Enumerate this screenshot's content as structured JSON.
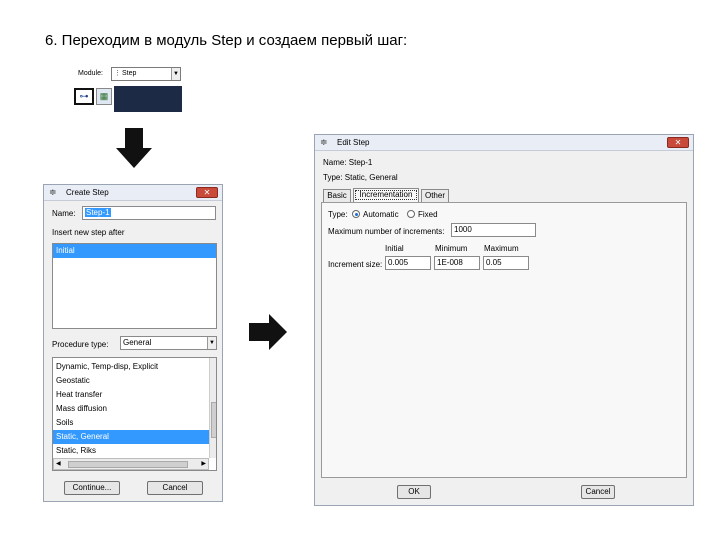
{
  "heading": "6. Переходим в модуль Step и создаем первый шаг:",
  "module_bar": {
    "label": "Module:",
    "value": "Step",
    "panel_color": "#1c2a45"
  },
  "create_step": {
    "title": "Create Step",
    "name_label": "Name:",
    "name_value": "Step-1",
    "insert_label": "Insert new step after",
    "after_items": [
      "Initial"
    ],
    "procedure_label": "Procedure type:",
    "procedure_value": "General",
    "procedures": [
      "Dynamic, Temp-disp, Explicit",
      "Geostatic",
      "Heat transfer",
      "Mass diffusion",
      "Soils",
      "Static, General",
      "Static, Riks"
    ],
    "selected_procedure": "Static, General",
    "continue_label": "Continue...",
    "cancel_label": "Cancel"
  },
  "edit_step": {
    "title": "Edit Step",
    "name_line": "Name: Step-1",
    "type_line": "Type: Static, General",
    "tabs": [
      "Basic",
      "Incrementation",
      "Other"
    ],
    "active_tab": "Incrementation",
    "type_label": "Type:",
    "type_automatic": "Automatic",
    "type_fixed": "Fixed",
    "max_increments_label": "Maximum number of increments:",
    "max_increments_value": "1000",
    "col_initial": "Initial",
    "col_minimum": "Minimum",
    "col_maximum": "Maximum",
    "increment_size_label": "Increment size:",
    "initial_value": "0.005",
    "minimum_value": "1E-008",
    "maximum_value": "0.05",
    "ok_label": "OK",
    "cancel_label": "Cancel"
  },
  "colors": {
    "selection": "#3399ff",
    "close_button": "#c94a3a"
  }
}
